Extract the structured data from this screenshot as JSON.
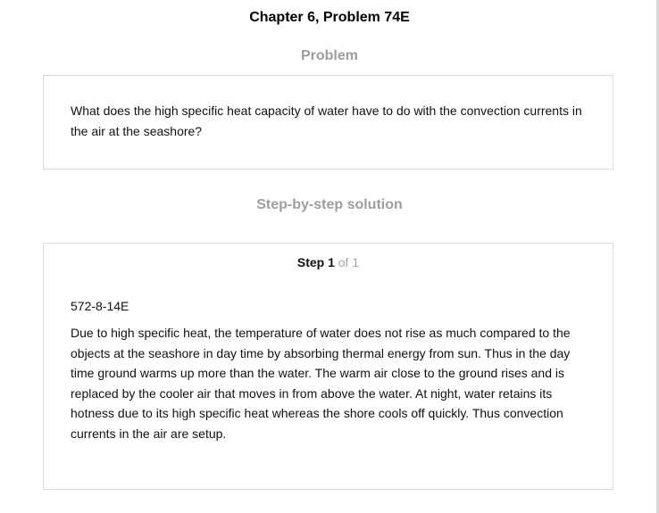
{
  "header": {
    "title": "Chapter 6, Problem 74E"
  },
  "problem": {
    "heading": "Problem",
    "text": "What does the high specific heat capacity of water have to do with the convection currents in the air at the seashore?"
  },
  "solution": {
    "heading": "Step-by-step solution",
    "step": {
      "label": "Step 1",
      "of_text": "of 1",
      "code": "572-8-14E",
      "text": "Due to high specific heat, the temperature of water does not rise as much compared to the objects at the seashore in day time by absorbing thermal energy from sun. Thus in the day time ground warms up more than the water. The warm air close to the ground rises and is replaced by the cooler air that moves in from above the water. At night, water retains its hotness due to its high specific heat whereas the shore cools off quickly. Thus convection currents in the air are setup."
    }
  }
}
